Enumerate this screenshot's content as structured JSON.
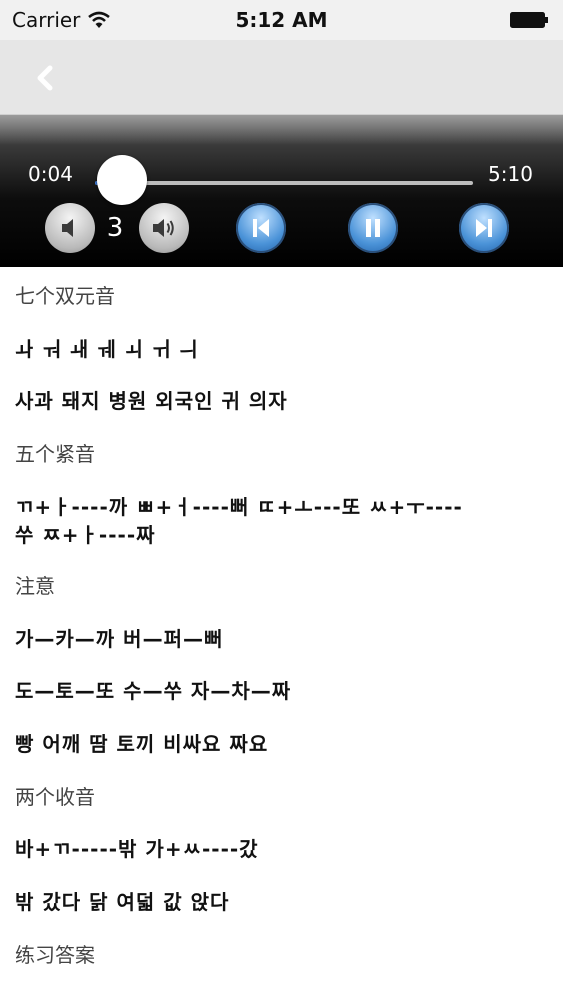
{
  "status_bar": {
    "carrier": "Carrier",
    "time": "5:12 AM"
  },
  "nav": {
    "back_icon": "chevron-left-icon"
  },
  "player": {
    "elapsed": "0:04",
    "total": "5:10",
    "progress": 0.013,
    "volume_level": "3",
    "accent": "#3b7de0"
  },
  "content": {
    "h1": "七个双元音",
    "l1": "ㅘ ㅝ ㅙ ㅞ ㅚ ㅟ ㅢ",
    "l2": "사과 돼지 병원 외국인 귀 의자",
    "h2": "五个紧音",
    "l3a": "ㄲ+ㅏ----까 ㅃ+ㅓ----뻐 ㄸ+ㅗ---또 ㅆ+ㅜ----",
    "l3b": "쑤 ㅉ+ㅏ----짜",
    "h3": "注意",
    "l4": "가—카—까 버—퍼—뻐",
    "l5": "도—토—또 수—쑤 자—차—짜",
    "l6": "빵 어깨 땀 토끼 비싸요 짜요",
    "h4": "两个收音",
    "l7": "바+ㄲ-----밖 가+ㅆ----갔",
    "l8": "밖 갔다 닭 여덟 값 앉다",
    "h5": "练习答案"
  }
}
